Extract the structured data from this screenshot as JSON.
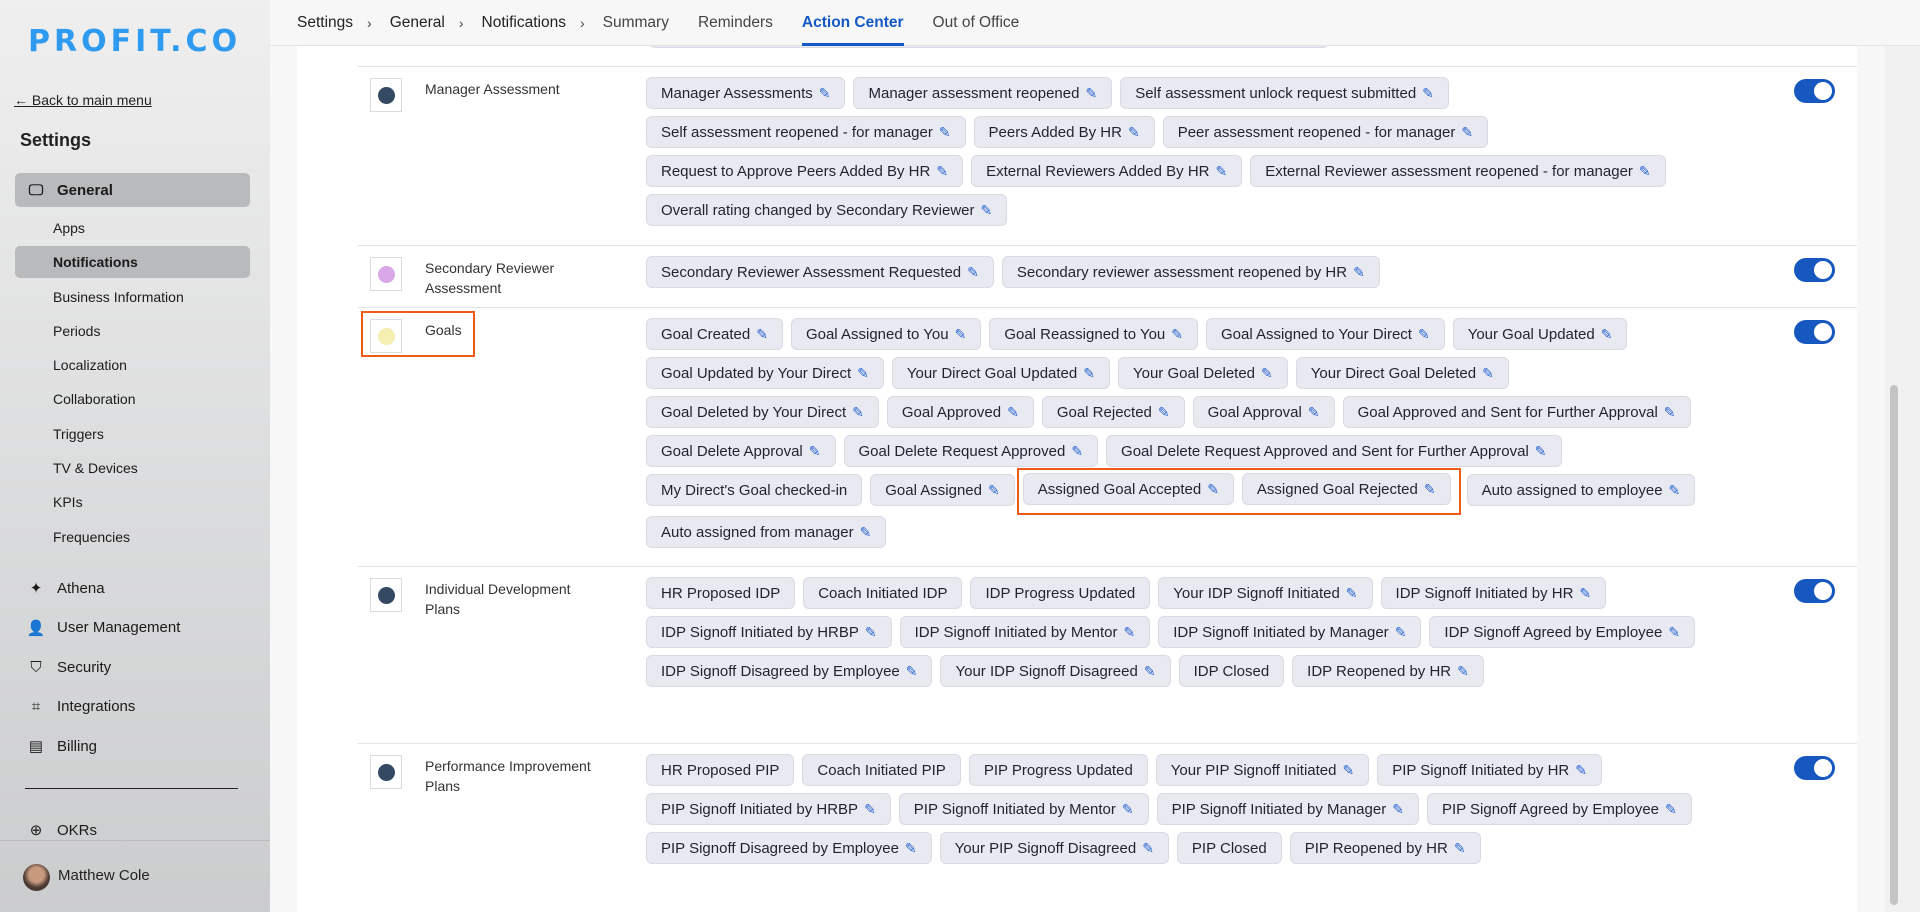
{
  "brand": {
    "logo": "PROFIT.CO"
  },
  "sidebar": {
    "back": "← Back to main menu",
    "title": "Settings",
    "general": "General",
    "sub": [
      "Apps",
      "Notifications",
      "Business Information",
      "Periods",
      "Localization",
      "Collaboration",
      "Triggers",
      "TV & Devices",
      "KPIs",
      "Frequencies"
    ],
    "main": [
      "Athena",
      "User Management",
      "Security",
      "Integrations",
      "Billing"
    ],
    "okrs": "OKRs",
    "user": "Matthew Cole"
  },
  "topnav": {
    "crumbs": [
      "Settings",
      "General",
      "Notifications"
    ],
    "tabs": [
      "Summary",
      "Reminders",
      "Action Center",
      "Out of Office"
    ],
    "active_tab": "Action Center"
  },
  "colors": {
    "accent": "#1657c0",
    "highlight": "#f05a1a"
  },
  "rows": [
    {
      "label": "Manager Assessment",
      "color": "#344a63",
      "enabled": true,
      "chips": [
        {
          "t": "Manager Assessments",
          "e": true
        },
        {
          "t": "Manager assessment reopened",
          "e": true
        },
        {
          "t": "Self assessment unlock request submitted",
          "e": true
        },
        {
          "t": "Self assessment reopened - for manager",
          "e": true
        },
        {
          "t": "Peers Added By HR",
          "e": true
        },
        {
          "t": "Peer assessment reopened - for manager",
          "e": true
        },
        {
          "t": "Request to Approve Peers Added By HR",
          "e": true
        },
        {
          "t": "External Reviewers Added By HR",
          "e": true
        },
        {
          "t": "External Reviewer assessment reopened - for manager",
          "e": true
        },
        {
          "t": "Overall rating changed by Secondary Reviewer",
          "e": true
        }
      ]
    },
    {
      "label": "Secondary Reviewer Assessment",
      "color": "#d9a8e8",
      "enabled": true,
      "chips": [
        {
          "t": "Secondary Reviewer Assessment Requested",
          "e": true
        },
        {
          "t": "Secondary reviewer assessment reopened by HR",
          "e": true
        }
      ]
    },
    {
      "label": "Goals",
      "color": "#f6efb2",
      "enabled": true,
      "highlight": true,
      "chips": [
        {
          "t": "Goal Created",
          "e": true
        },
        {
          "t": "Goal Assigned to You",
          "e": true
        },
        {
          "t": "Goal Reassigned to You",
          "e": true
        },
        {
          "t": "Goal Assigned to Your Direct",
          "e": true
        },
        {
          "t": "Your Goal Updated",
          "e": true
        },
        {
          "t": "Goal Updated by Your Direct",
          "e": true
        },
        {
          "t": "Your Direct Goal Updated",
          "e": true
        },
        {
          "t": "Your Goal Deleted",
          "e": true
        },
        {
          "t": "Your Direct Goal Deleted",
          "e": true
        },
        {
          "t": "Goal Deleted by Your Direct",
          "e": true
        },
        {
          "t": "Goal Approved",
          "e": true
        },
        {
          "t": "Goal Rejected",
          "e": true
        },
        {
          "t": "Goal Approval",
          "e": true
        },
        {
          "t": "Goal Approved and Sent for Further Approval",
          "e": true
        },
        {
          "t": "Goal Delete Approval",
          "e": true
        },
        {
          "t": "Goal Delete Request Approved",
          "e": true
        },
        {
          "t": "Goal Delete Request Approved and Sent for Further Approval",
          "e": true
        },
        {
          "t": "My Direct's Goal checked-in",
          "e": false
        },
        {
          "t": "Goal Assigned",
          "e": true
        },
        {
          "t": "Assigned Goal Accepted",
          "e": true,
          "h": true
        },
        {
          "t": "Assigned Goal Rejected",
          "e": true,
          "h": true
        },
        {
          "t": "Auto assigned to employee",
          "e": true
        },
        {
          "t": "Auto assigned from manager",
          "e": true
        }
      ]
    },
    {
      "label": "Individual Development Plans",
      "color": "#344a63",
      "enabled": true,
      "chips": [
        {
          "t": "HR Proposed IDP",
          "e": false
        },
        {
          "t": "Coach Initiated IDP",
          "e": false
        },
        {
          "t": "IDP Progress Updated",
          "e": false
        },
        {
          "t": "Your IDP Signoff Initiated",
          "e": true
        },
        {
          "t": "IDP Signoff Initiated by HR",
          "e": true
        },
        {
          "t": "IDP Signoff Initiated by HRBP",
          "e": true
        },
        {
          "t": "IDP Signoff Initiated by Mentor",
          "e": true
        },
        {
          "t": "IDP Signoff Initiated by Manager",
          "e": true
        },
        {
          "t": "IDP Signoff Agreed by Employee",
          "e": true
        },
        {
          "t": "IDP Signoff Disagreed by Employee",
          "e": true
        },
        {
          "t": "Your IDP Signoff Disagreed",
          "e": true
        },
        {
          "t": "IDP Closed",
          "e": false
        },
        {
          "t": "IDP Reopened by HR",
          "e": true
        }
      ]
    },
    {
      "label": "Performance Improvement Plans",
      "color": "#344a63",
      "enabled": true,
      "chips": [
        {
          "t": "HR Proposed PIP",
          "e": false
        },
        {
          "t": "Coach Initiated PIP",
          "e": false
        },
        {
          "t": "PIP Progress Updated",
          "e": false
        },
        {
          "t": "Your PIP Signoff Initiated",
          "e": true
        },
        {
          "t": "PIP Signoff Initiated by HR",
          "e": true
        },
        {
          "t": "PIP Signoff Initiated by HRBP",
          "e": true
        },
        {
          "t": "PIP Signoff Initiated by Mentor",
          "e": true
        },
        {
          "t": "PIP Signoff Initiated by Manager",
          "e": true
        },
        {
          "t": "PIP Signoff Agreed by Employee",
          "e": true
        },
        {
          "t": "PIP Signoff Disagreed by Employee",
          "e": true
        },
        {
          "t": "Your PIP Signoff Disagreed",
          "e": true
        },
        {
          "t": "PIP Closed",
          "e": false
        },
        {
          "t": "PIP Reopened by HR",
          "e": true
        }
      ]
    }
  ]
}
